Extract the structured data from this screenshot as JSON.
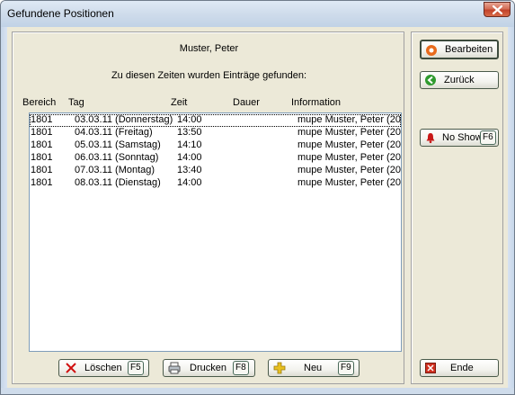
{
  "window": {
    "title": "Gefundene Positionen"
  },
  "header": {
    "name": "Muster, Peter",
    "info": "Zu diesen Zeiten wurden Einträge gefunden:"
  },
  "table": {
    "columns": [
      "Bereich",
      "Tag",
      "Zeit",
      "Dauer",
      "Information"
    ],
    "rows": [
      [
        "1801",
        "03.03.11 (Donnerstag)",
        "14:00",
        "",
        "mupe  Muster, Peter (20."
      ],
      [
        "1801",
        "04.03.11 (Freitag)",
        "13:50",
        "",
        "mupe  Muster, Peter (20."
      ],
      [
        "1801",
        "05.03.11 (Samstag)",
        "14:10",
        "",
        "mupe  Muster, Peter (20."
      ],
      [
        "1801",
        "06.03.11 (Sonntag)",
        "14:00",
        "",
        "mupe  Muster, Peter (20."
      ],
      [
        "1801",
        "07.03.11 (Montag)",
        "13:40",
        "",
        "mupe  Muster, Peter (20."
      ],
      [
        "1801",
        "08.03.11 (Dienstag)",
        "14:00",
        "",
        "mupe  Muster, Peter (20."
      ]
    ]
  },
  "buttons": {
    "delete": {
      "label": "Löschen",
      "key": "F5"
    },
    "print": {
      "label": "Drucken",
      "key": "F8"
    },
    "new": {
      "label": "Neu",
      "key": "F9"
    },
    "edit": {
      "label": "Bearbeiten"
    },
    "back": {
      "label": "Zurück"
    },
    "noshow": {
      "label": "No Show",
      "key": "F6"
    },
    "end": {
      "label": "Ende"
    }
  },
  "colors": {
    "titlebar": "#cfdceb",
    "client": "#ece9d8",
    "close": "#c2432b",
    "edit_icon": "#e86a1c",
    "back_icon": "#2e9a2e",
    "noshow_icon": "#c81818",
    "delete_icon": "#d01010",
    "new_icon": "#e8c020",
    "end_icon": "#d03020"
  }
}
